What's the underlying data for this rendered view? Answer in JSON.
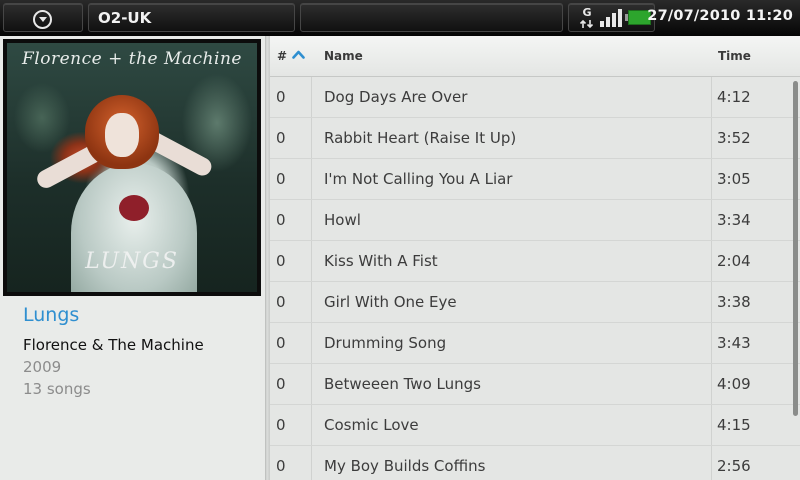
{
  "status_bar": {
    "carrier": "O2-UK",
    "network_type": "G",
    "datetime": "27/07/2010 11:20",
    "icons": [
      "menu-circle-icon",
      "data-g-icon",
      "signal-strength-icon",
      "battery-icon"
    ],
    "battery_color": "#2da52d"
  },
  "album": {
    "cover_title_text": "Florence + the Machine",
    "cover_album_text": "LUNGS",
    "title": "Lungs",
    "artist": "Florence & The Machine",
    "year": "2009",
    "song_count": "13 songs",
    "title_color": "#2f8fd0"
  },
  "track_list": {
    "columns": {
      "number": "#",
      "name": "Name",
      "time": "Time"
    },
    "sort": {
      "column": "number",
      "direction": "ascending",
      "icon": "chevron-up-icon",
      "color": "#2f8fd0"
    },
    "tracks": [
      {
        "number": "0",
        "name": "Dog Days Are Over",
        "time": "4:12"
      },
      {
        "number": "0",
        "name": "Rabbit Heart (Raise It Up)",
        "time": "3:52"
      },
      {
        "number": "0",
        "name": "I'm Not Calling You A Liar",
        "time": "3:05"
      },
      {
        "number": "0",
        "name": "Howl",
        "time": "3:34"
      },
      {
        "number": "0",
        "name": "Kiss With A Fist",
        "time": "2:04"
      },
      {
        "number": "0",
        "name": "Girl With One Eye",
        "time": "3:38"
      },
      {
        "number": "0",
        "name": "Drumming Song",
        "time": "3:43"
      },
      {
        "number": "0",
        "name": "Betweeen Two Lungs",
        "time": "4:09"
      },
      {
        "number": "0",
        "name": "Cosmic Love",
        "time": "4:15"
      },
      {
        "number": "0",
        "name": "My Boy Builds Coffins",
        "time": "2:56"
      }
    ]
  }
}
